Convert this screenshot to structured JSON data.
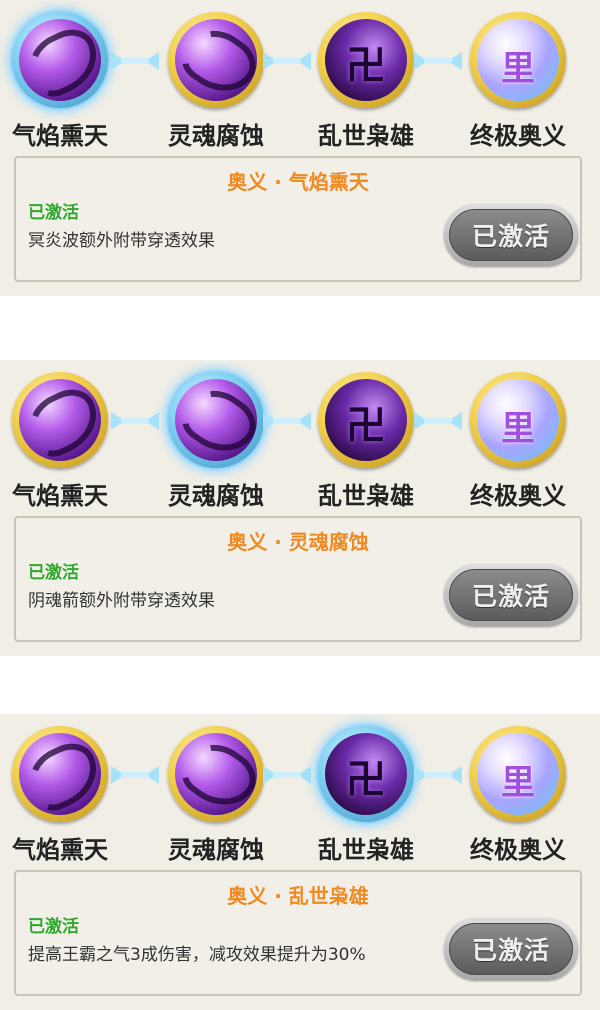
{
  "skills": [
    {
      "name": "气焰熏天",
      "icon": "flame-swirl-icon"
    },
    {
      "name": "灵魂腐蚀",
      "icon": "soul-corrosion-icon"
    },
    {
      "name": "乱世枭雄",
      "icon": "dark-rune-icon"
    },
    {
      "name": "终极奥义",
      "icon": "ultimate-orb-icon",
      "glyph": "里"
    }
  ],
  "panels": [
    {
      "selected": 0,
      "title": "奥义 · 气焰熏天",
      "status": "已激活",
      "description": "冥炎波额外附带穿透效果",
      "button": "已激活"
    },
    {
      "selected": 1,
      "title": "奥义 · 灵魂腐蚀",
      "status": "已激活",
      "description": "阴魂箭额外附带穿透效果",
      "button": "已激活"
    },
    {
      "selected": 2,
      "title": "奥义 · 乱世枭雄",
      "status": "已激活",
      "description": "提高王霸之气3成伤害，减攻效果提升为30%",
      "button": "已激活"
    }
  ],
  "colors": {
    "title": "#ef8a22",
    "status": "#2ea82e",
    "ring_gold": "#e2b73a",
    "ring_selected": "#8fd6ff",
    "connector": "#a8e2f8"
  }
}
